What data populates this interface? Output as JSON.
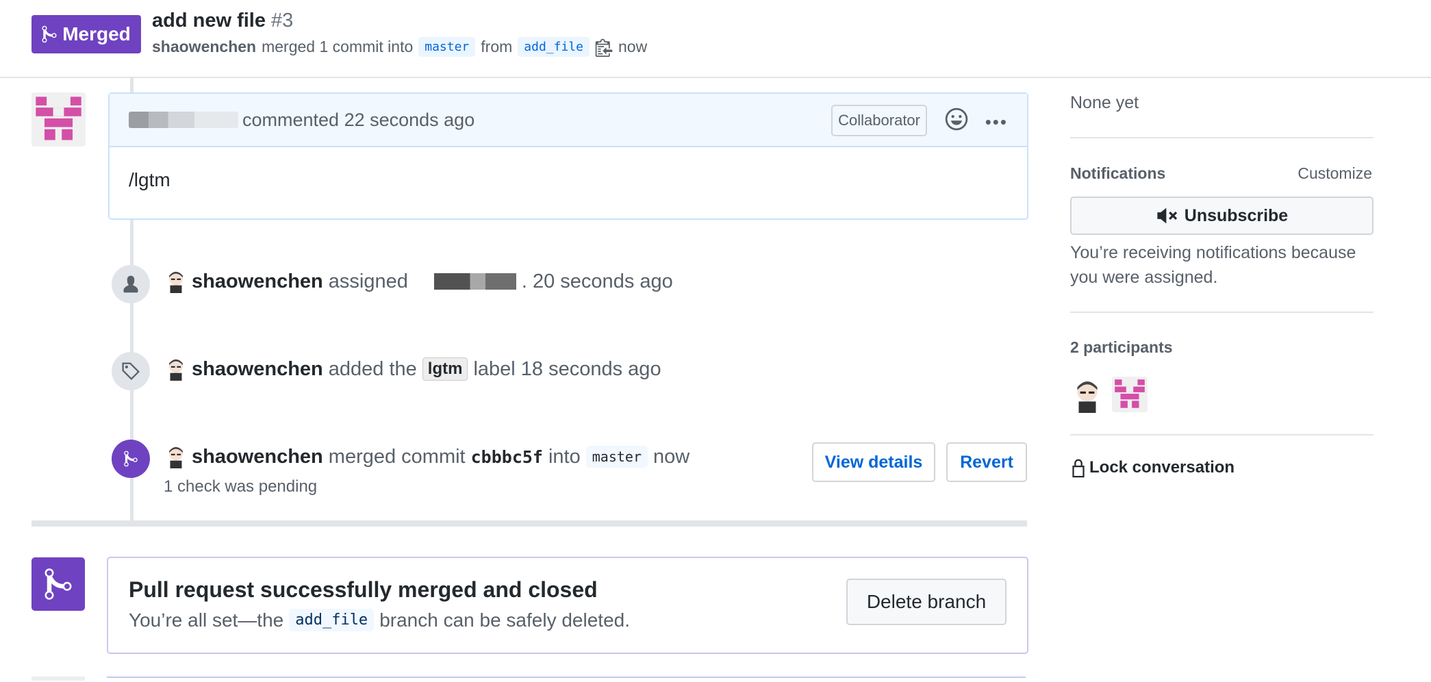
{
  "header": {
    "status_badge": "Merged",
    "title": "add new file",
    "number": "#3",
    "author": "shaowenchen",
    "merged_text": "merged 1 commit into",
    "base_branch": "master",
    "from_text": "from",
    "head_branch": "add_file",
    "time": "now"
  },
  "comment": {
    "action": "commented 22 seconds ago",
    "role_badge": "Collaborator",
    "body": "/lgtm"
  },
  "events": [
    {
      "user": "shaowenchen",
      "action": "assigned",
      "time": ". 20 seconds ago"
    },
    {
      "user": "shaowenchen",
      "action": "added the",
      "label": "lgtm",
      "time": "label 18 seconds ago"
    },
    {
      "user": "shaowenchen",
      "action": "merged commit",
      "commit": "cbbbc5f",
      "into": "into",
      "branch": "master",
      "time": "now",
      "check": "1 check was pending",
      "view_details": "View details",
      "revert": "Revert"
    }
  ],
  "merge_box": {
    "title": "Pull request successfully merged and closed",
    "desc_pre": "You’re all set—the",
    "branch": "add_file",
    "desc_post": "branch can be safely deleted.",
    "delete_button": "Delete branch"
  },
  "sidebar": {
    "milestone_value": "None yet",
    "notifications_heading": "Notifications",
    "customize": "Customize",
    "unsubscribe": "Unsubscribe",
    "reason": "You’re receiving notifications because",
    "reason2": "you were assigned.",
    "participants": "2 participants",
    "lock": "Lock conversation"
  },
  "colors": {
    "merged_purple": "#6f42c1",
    "link_blue": "#0366d6",
    "comment_border": "#c8e1ff"
  }
}
